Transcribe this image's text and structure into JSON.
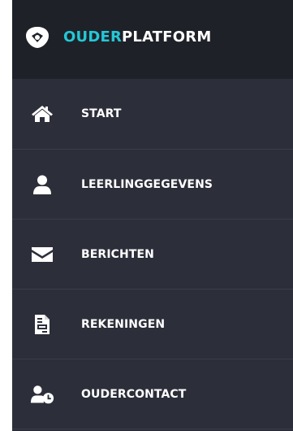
{
  "brand": {
    "accent": "OUDER",
    "rest": "PLATFORM",
    "accent_color": "#23c8d6"
  },
  "nav": {
    "items": [
      {
        "label": "START",
        "icon": "home-icon"
      },
      {
        "label": "LEERLINGGEGEVENS",
        "icon": "user-icon"
      },
      {
        "label": "BERICHTEN",
        "icon": "envelope-icon"
      },
      {
        "label": "REKENINGEN",
        "icon": "invoice-icon"
      },
      {
        "label": "OUDERCONTACT",
        "icon": "user-clock-icon"
      }
    ]
  }
}
